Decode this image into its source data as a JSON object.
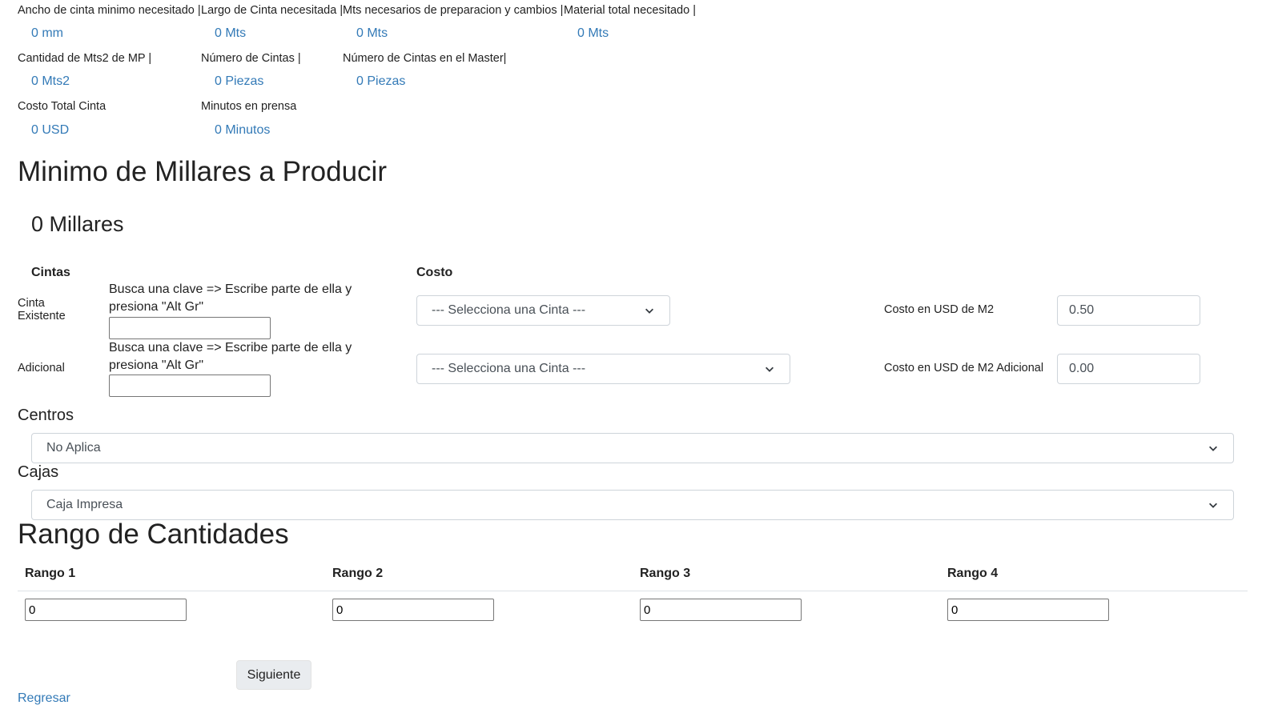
{
  "summary": {
    "row1": {
      "labels": [
        "Ancho de cinta minimo necesitado |",
        "Largo de Cinta necesitada |",
        "Mts necesarios de preparacion y cambios |",
        "Material total necesitado |"
      ],
      "values": [
        "0 mm",
        "0 Mts",
        "0 Mts",
        "0 Mts"
      ]
    },
    "row2": {
      "labels": [
        "Cantidad de Mts2 de MP |",
        "Número de Cintas |",
        "Número de Cintas en el Master|"
      ],
      "values": [
        "0 Mts2",
        "0 Piezas",
        "0 Piezas"
      ]
    },
    "row3": {
      "labels": [
        "Costo Total Cinta",
        "Minutos en prensa"
      ],
      "values": [
        "0 USD",
        "0 Minutos"
      ]
    }
  },
  "minimo": {
    "title": "Minimo de Millares a Producir",
    "value": "0 Millares"
  },
  "cintas": {
    "header_cintas": "Cintas",
    "header_costo": "Costo",
    "existente": {
      "label": "Cinta Existente",
      "hint": "Busca una clave => Escribe parte de ella y presiona \"Alt Gr\"",
      "search_value": "",
      "select_value": "--- Selecciona una Cinta ---",
      "cost_label": "Costo en USD de M2",
      "cost_value": "0.50"
    },
    "adicional": {
      "label": "Adicional",
      "hint": "Busca una clave => Escribe parte de ella y presiona \"Alt Gr\"",
      "search_value": "",
      "select_value": "--- Selecciona una Cinta ---",
      "cost_label": "Costo en USD de M2 Adicional",
      "cost_value": "0.00"
    }
  },
  "centros": {
    "label": "Centros",
    "select_value": "No Aplica"
  },
  "cajas": {
    "label": "Cajas",
    "select_value": "Caja Impresa"
  },
  "rangos": {
    "title": "Rango de Cantidades",
    "items": [
      {
        "label": "Rango 1",
        "value": "0"
      },
      {
        "label": "Rango 2",
        "value": "0"
      },
      {
        "label": "Rango 3",
        "value": "0"
      },
      {
        "label": "Rango 4",
        "value": "0"
      }
    ]
  },
  "actions": {
    "next_label": "Siguiente",
    "back_label": "Regresar"
  },
  "icons": {
    "select_arrow": "chevron-down-icon"
  }
}
